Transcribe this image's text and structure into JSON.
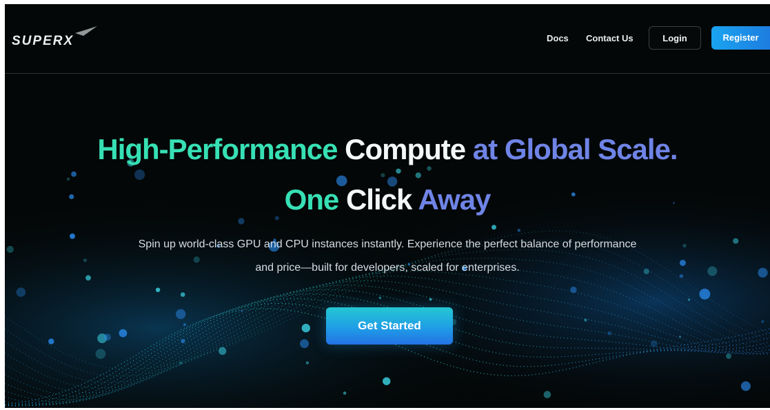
{
  "brand": {
    "logo_text": "SUPERX"
  },
  "nav": {
    "docs": "Docs",
    "contact": "Contact Us",
    "login": "Login",
    "register": "Register"
  },
  "hero": {
    "line1": {
      "part1": "High-Performance",
      "part2": "Compute",
      "part3": "at",
      "part4": "Global Scale."
    },
    "line2": {
      "part1": "One",
      "part2": "Click",
      "part3": "Away"
    },
    "subtitle_line1": "Spin up world-class GPU and CPU instances instantly. Experience the perfect balance of performance",
    "subtitle_line2": "and price—built for developers, scaled for enterprises.",
    "cta": "Get Started"
  },
  "colors": {
    "background": "#040707",
    "accent_teal": "#37e0b4",
    "accent_blue": "#6f84e6",
    "button_blue": "#1d8fe6"
  }
}
